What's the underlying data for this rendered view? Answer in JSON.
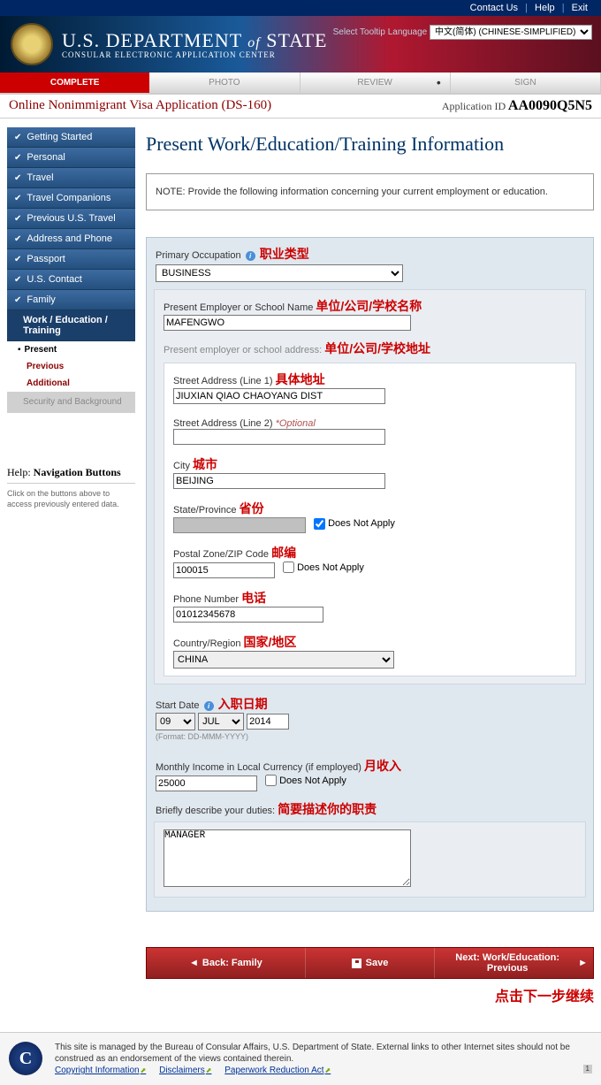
{
  "top": {
    "contact": "Contact Us",
    "help": "Help",
    "exit": "Exit"
  },
  "header": {
    "dept": "U.S. DEPARTMENT",
    "of": "of",
    "state": "STATE",
    "sub": "CONSULAR ELECTRONIC APPLICATION CENTER",
    "tooltip_label": "Select Tooltip Language",
    "lang_selected": "中文(简体) (CHINESE-SIMPLIFIED)"
  },
  "tabs": {
    "complete": "COMPLETE",
    "photo": "PHOTO",
    "review": "REVIEW",
    "sign": "SIGN"
  },
  "app": {
    "title": "Online Nonimmigrant Visa Application (DS-160)",
    "id_label": "Application ID",
    "id": "AA0090Q5N5"
  },
  "sidebar": {
    "items": [
      "Getting Started",
      "Personal",
      "Travel",
      "Travel Companions",
      "Previous U.S. Travel",
      "Address and Phone",
      "Passport",
      "U.S. Contact",
      "Family"
    ],
    "active": "Work / Education / Training",
    "subs": {
      "present": "Present",
      "previous": "Previous",
      "additional": "Additional",
      "security": "Security and Background"
    },
    "help_label": "Help:",
    "help_title": "Navigation Buttons",
    "help_text": "Click on the buttons above to access previously entered data."
  },
  "page": {
    "heading": "Present Work/Education/Training Information",
    "note": "NOTE: Provide the following information concerning your current employment or education."
  },
  "form": {
    "primary_occupation_label": "Primary Occupation",
    "primary_occupation_ann": "职业类型",
    "primary_occupation_value": "BUSINESS",
    "employer_label": "Present Employer or School Name",
    "employer_ann": "单位/公司/学校名称",
    "employer_value": "MAFENGWO",
    "address_label": "Present employer or school address:",
    "address_ann": "单位/公司/学校地址",
    "line1_label": "Street Address (Line 1)",
    "line1_ann": "具体地址",
    "line1_value": "JIUXIAN QIAO CHAOYANG DIST",
    "line2_label": "Street Address (Line 2)",
    "optional": "*Optional",
    "line2_value": "",
    "city_label": "City",
    "city_ann": "城市",
    "city_value": "BEIJING",
    "state_label": "State/Province",
    "state_ann": "省份",
    "dna": "Does Not Apply",
    "postal_label": "Postal Zone/ZIP Code",
    "postal_ann": "邮编",
    "postal_value": "100015",
    "phone_label": "Phone Number",
    "phone_ann": "电话",
    "phone_value": "01012345678",
    "country_label": "Country/Region",
    "country_ann": "国家/地区",
    "country_value": "CHINA",
    "start_label": "Start Date",
    "start_ann": "入职日期",
    "start_day": "09",
    "start_month": "JUL",
    "start_year": "2014",
    "format_hint": "(Format: DD-MMM-YYYY)",
    "income_label": "Monthly Income in Local Currency (if employed)",
    "income_ann": "月收入",
    "income_value": "25000",
    "duties_label": "Briefly describe your duties:",
    "duties_ann": "简要描述你的职责",
    "duties_value": "MANAGER"
  },
  "nav": {
    "back": "Back: Family",
    "save": "Save",
    "next": "Next: Work/Education: Previous",
    "next_ann": "点击下一步继续"
  },
  "footer": {
    "text": "This site is managed by the Bureau of Consular Affairs, U.S. Department of State. External links to other Internet sites should not be construed as an endorsement of the views contained therein.",
    "link1": "Copyright Information",
    "link2": "Disclaimers",
    "link3": "Paperwork Reduction Act",
    "page": "1"
  }
}
